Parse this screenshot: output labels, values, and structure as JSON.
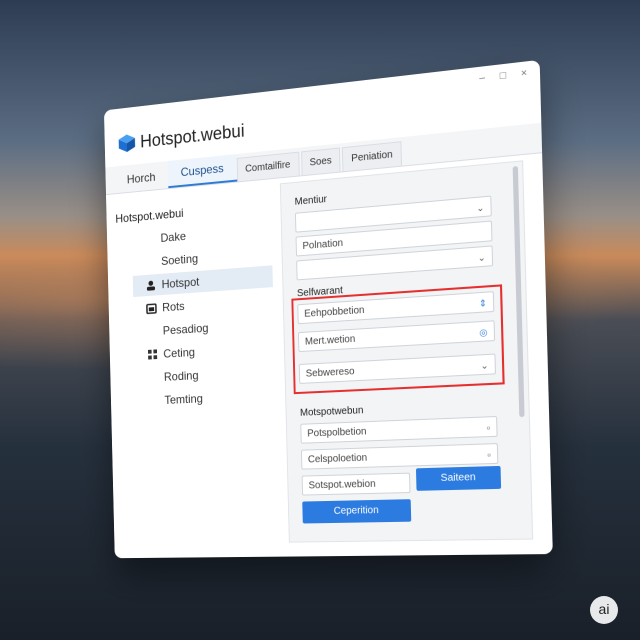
{
  "app": {
    "title": "Hotspot.webui",
    "logo_icon": "cube-logo-icon",
    "accent_color": "#2c7be0",
    "highlight_color": "#e53030"
  },
  "window_controls": {
    "minimize": "–",
    "maximize": "□",
    "close": "×"
  },
  "tabs": [
    {
      "label": "Horch",
      "active": false
    },
    {
      "label": "Cuspess",
      "active": true
    },
    {
      "label": "Comtailfire",
      "active": false
    },
    {
      "label": "Soes",
      "active": false
    },
    {
      "label": "Peniation",
      "active": false
    }
  ],
  "sidebar": {
    "heading": "Hotspot.webui",
    "items": [
      {
        "label": "Dake",
        "icon": null
      },
      {
        "label": "Soeting",
        "icon": null
      },
      {
        "label": "Hotspot",
        "icon": "user-icon",
        "active": true
      },
      {
        "label": "Rots",
        "icon": "calendar-icon"
      },
      {
        "label": "Pesadiog",
        "icon": null
      },
      {
        "label": "Ceting",
        "icon": "grid-icon"
      },
      {
        "label": "Roding",
        "icon": null
      },
      {
        "label": "Temting",
        "icon": null
      }
    ]
  },
  "form": {
    "section1_label": "Mentiur",
    "field1_value": "Polnation",
    "section2_label": "Selfwarant",
    "field2_value": "Eehpobbetion",
    "field3_value": "Mert.wetion",
    "field4_value": "Sebwereso",
    "section3_label": "Motspotwebun",
    "field5_value": "Potspolbetion",
    "field6_value": "Celspoloetion",
    "field7_value": "Sotspot.webion",
    "primary_button": "Ceperition",
    "secondary_button": "Saiteen"
  },
  "badge": {
    "label": "ai"
  }
}
